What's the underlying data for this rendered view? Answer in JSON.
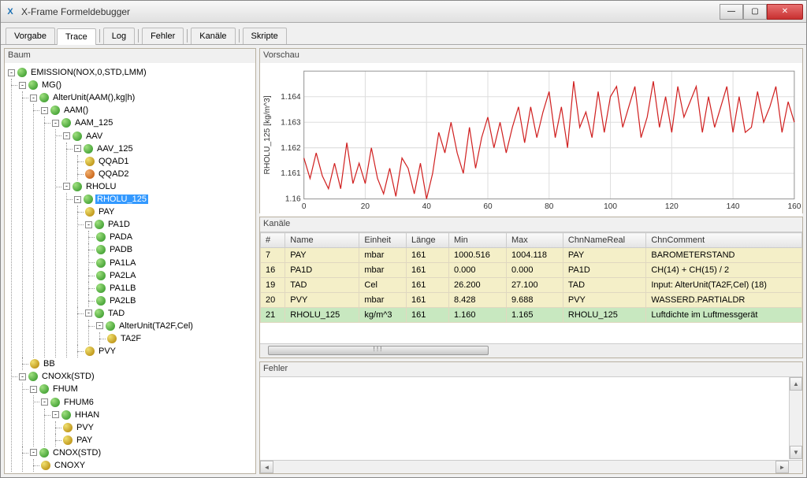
{
  "window": {
    "title": "X-Frame Formeldebugger",
    "icon_label": "X"
  },
  "tabs": [
    "Vorgabe",
    "Trace",
    "Log",
    "Fehler",
    "Kanäle",
    "Skripte"
  ],
  "active_tab": "Trace",
  "tree_panel_title": "Baum",
  "tree": {
    "root": "EMISSION(NOX,0,STD,LMM)",
    "mg": "MG()",
    "alterunit1": "AlterUnit(AAM(),kg|h)",
    "aam": "AAM()",
    "aam125": "AAM_125",
    "aav": "AAV",
    "aav125": "AAV_125",
    "qqad1": "QQAD1",
    "qqad2": "QQAD2",
    "rholu": "RHOLU",
    "rholu125": "RHOLU_125",
    "pay": "PAY",
    "pa1d": "PA1D",
    "pada": "PADA",
    "padb": "PADB",
    "pa1la": "PA1LA",
    "pa2la": "PA2LA",
    "pa1lb": "PA1LB",
    "pa2lb": "PA2LB",
    "tad": "TAD",
    "alterunit2": "AlterUnit(TA2F,Cel)",
    "ta2f": "TA2F",
    "pvy": "PVY",
    "bb": "BB",
    "cnoxk": "CNOXk(STD)",
    "fhum": "FHUM",
    "fhum6": "FHUM6",
    "hhan": "HHAN",
    "pvy2": "PVY",
    "pay2": "PAY",
    "cnox": "CNOX(STD)",
    "cnoxy": "CNOXY"
  },
  "chart_panel_title": "Vorschau",
  "chart_data": {
    "type": "line",
    "ylabel": "RHOLU_125 [kg/m^3]",
    "xlabel": "",
    "xlim": [
      0,
      160
    ],
    "ylim": [
      1.16,
      1.165
    ],
    "xticks": [
      0,
      20,
      40,
      60,
      80,
      100,
      120,
      140,
      160
    ],
    "yticks": [
      1.16,
      1.161,
      1.162,
      1.163,
      1.164
    ],
    "ytick_labels": [
      "1.16",
      "1.161",
      "1.162",
      "1.163",
      "1.164"
    ],
    "series": [
      {
        "name": "RHOLU_125",
        "color": "#d02020",
        "x": [
          0,
          2,
          4,
          6,
          8,
          10,
          12,
          14,
          16,
          18,
          20,
          22,
          24,
          26,
          28,
          30,
          32,
          34,
          36,
          38,
          40,
          42,
          44,
          46,
          48,
          50,
          52,
          54,
          56,
          58,
          60,
          62,
          64,
          66,
          68,
          70,
          72,
          74,
          76,
          78,
          80,
          82,
          84,
          86,
          88,
          90,
          92,
          94,
          96,
          98,
          100,
          102,
          104,
          106,
          108,
          110,
          112,
          114,
          116,
          118,
          120,
          122,
          124,
          126,
          128,
          130,
          132,
          134,
          136,
          138,
          140,
          142,
          144,
          146,
          148,
          150,
          152,
          154,
          156,
          158,
          160
        ],
        "y": [
          1.1616,
          1.1608,
          1.1618,
          1.1609,
          1.1604,
          1.1614,
          1.1604,
          1.1622,
          1.1606,
          1.1614,
          1.1606,
          1.162,
          1.1608,
          1.1602,
          1.1612,
          1.1601,
          1.1616,
          1.1612,
          1.1602,
          1.1614,
          1.16,
          1.161,
          1.1626,
          1.1618,
          1.163,
          1.1618,
          1.161,
          1.1628,
          1.1612,
          1.1624,
          1.1632,
          1.162,
          1.163,
          1.1618,
          1.1628,
          1.1636,
          1.1622,
          1.1636,
          1.1624,
          1.1634,
          1.1642,
          1.1624,
          1.1636,
          1.162,
          1.1646,
          1.1628,
          1.1634,
          1.1624,
          1.1642,
          1.1626,
          1.164,
          1.1644,
          1.1628,
          1.1636,
          1.1644,
          1.1624,
          1.1632,
          1.1646,
          1.1628,
          1.164,
          1.1626,
          1.1644,
          1.1632,
          1.1638,
          1.1644,
          1.1626,
          1.164,
          1.1628,
          1.1636,
          1.1644,
          1.1626,
          1.164,
          1.1626,
          1.1628,
          1.1642,
          1.163,
          1.1636,
          1.1644,
          1.1626,
          1.1638,
          1.163
        ]
      }
    ]
  },
  "kan_panel_title": "Kanäle",
  "table": {
    "headers": [
      "#",
      "Name",
      "Einheit",
      "Länge",
      "Min",
      "Max",
      "ChnNameReal",
      "ChnComment"
    ],
    "rows": [
      {
        "cls": "ylw",
        "cells": [
          "7",
          "PAY",
          "mbar",
          "161",
          "1000.516",
          "1004.118",
          "PAY",
          "BAROMETERSTAND"
        ]
      },
      {
        "cls": "ylw",
        "cells": [
          "16",
          "PA1D",
          "mbar",
          "161",
          "0.000",
          "0.000",
          "PA1D",
          " CH(14) + CH(15) / 2"
        ]
      },
      {
        "cls": "ylw",
        "cells": [
          "19",
          "TAD",
          "Cel",
          "161",
          "26.200",
          "27.100",
          "TAD",
          "Input: AlterUnit(TA2F,Cel) (18)"
        ]
      },
      {
        "cls": "ylw",
        "cells": [
          "20",
          "PVY",
          "mbar",
          "161",
          "8.428",
          "9.688",
          "PVY",
          "WASSERD.PARTIALDR"
        ]
      },
      {
        "cls": "grn",
        "cells": [
          "21",
          "RHOLU_125",
          "kg/m^3",
          "161",
          "1.160",
          "1.165",
          "RHOLU_125",
          "Luftdichte im Luftmessgerät"
        ]
      }
    ]
  },
  "fehler_panel_title": "Fehler"
}
